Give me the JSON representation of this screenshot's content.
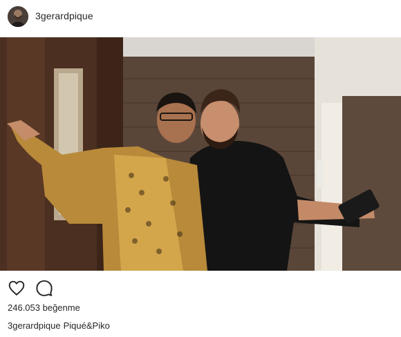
{
  "post": {
    "username": "3gerardpique",
    "likes_text": "246.053 beğenme",
    "caption_user": "3gerardpique",
    "caption_text": "Piqué&Piko"
  },
  "icons": {
    "like": "heart-icon",
    "comment": "comment-icon"
  },
  "colors": {
    "text": "#262626",
    "background": "#ffffff"
  }
}
